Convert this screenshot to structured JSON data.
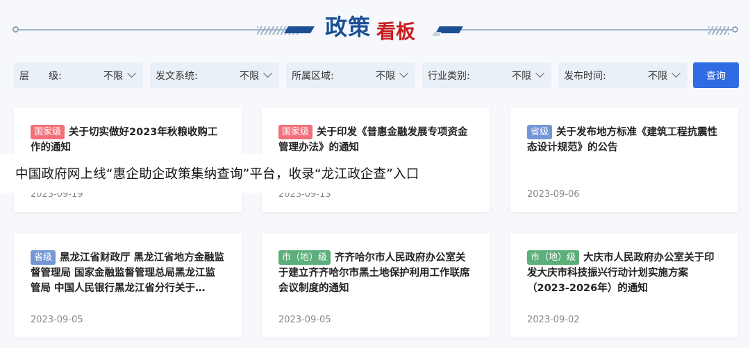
{
  "header": {
    "title_part1": "政策",
    "title_part2": "看板",
    "colors": {
      "blue": "#1b4f93",
      "red": "#c81e1e"
    }
  },
  "filters": [
    {
      "label": "层　　级:",
      "value": "不限"
    },
    {
      "label": "发文系统:",
      "value": "不限"
    },
    {
      "label": "所属区域:",
      "value": "不限"
    },
    {
      "label": "行业类别:",
      "value": "不限"
    },
    {
      "label": "发布时间:",
      "value": "不限"
    }
  ],
  "query_button": "查询",
  "cards": [
    {
      "tag": "国家级",
      "tag_type": "national",
      "title": "关于切实做好2023年秋粮收购工作的通知",
      "date": "2023-09-19"
    },
    {
      "tag": "国家级",
      "tag_type": "national",
      "title": "关于印发《普惠金融发展专项资金管理办法》的通知",
      "date": "2023-09-13"
    },
    {
      "tag": "省级",
      "tag_type": "province",
      "title": "关于发布地方标准《建筑工程抗震性态设计规范》的公告",
      "date": "2023-09-06"
    },
    {
      "tag": "省级",
      "tag_type": "province",
      "title": "黑龙江省财政厅 黑龙江省地方金融监督管理局 国家金融监督管理总局黑龙江监管局 中国人民银行黑龙江省分行关于…",
      "date": "2023-09-05"
    },
    {
      "tag": "市（地）级",
      "tag_type": "city",
      "title": "齐齐哈尔市人民政府办公室关于建立齐齐哈尔市黑土地保护利用工作联席会议制度的通知",
      "date": "2023-09-05"
    },
    {
      "tag": "市（地）级",
      "tag_type": "city",
      "title": "大庆市人民政府办公室关于印发大庆市科技振兴行动计划实施方案（2023-2026年）的通知",
      "date": "2023-09-02"
    }
  ],
  "overlay_text": "中国政府网上线“惠企助企政策集纳查询”平台，收录“龙江政企查”入口"
}
